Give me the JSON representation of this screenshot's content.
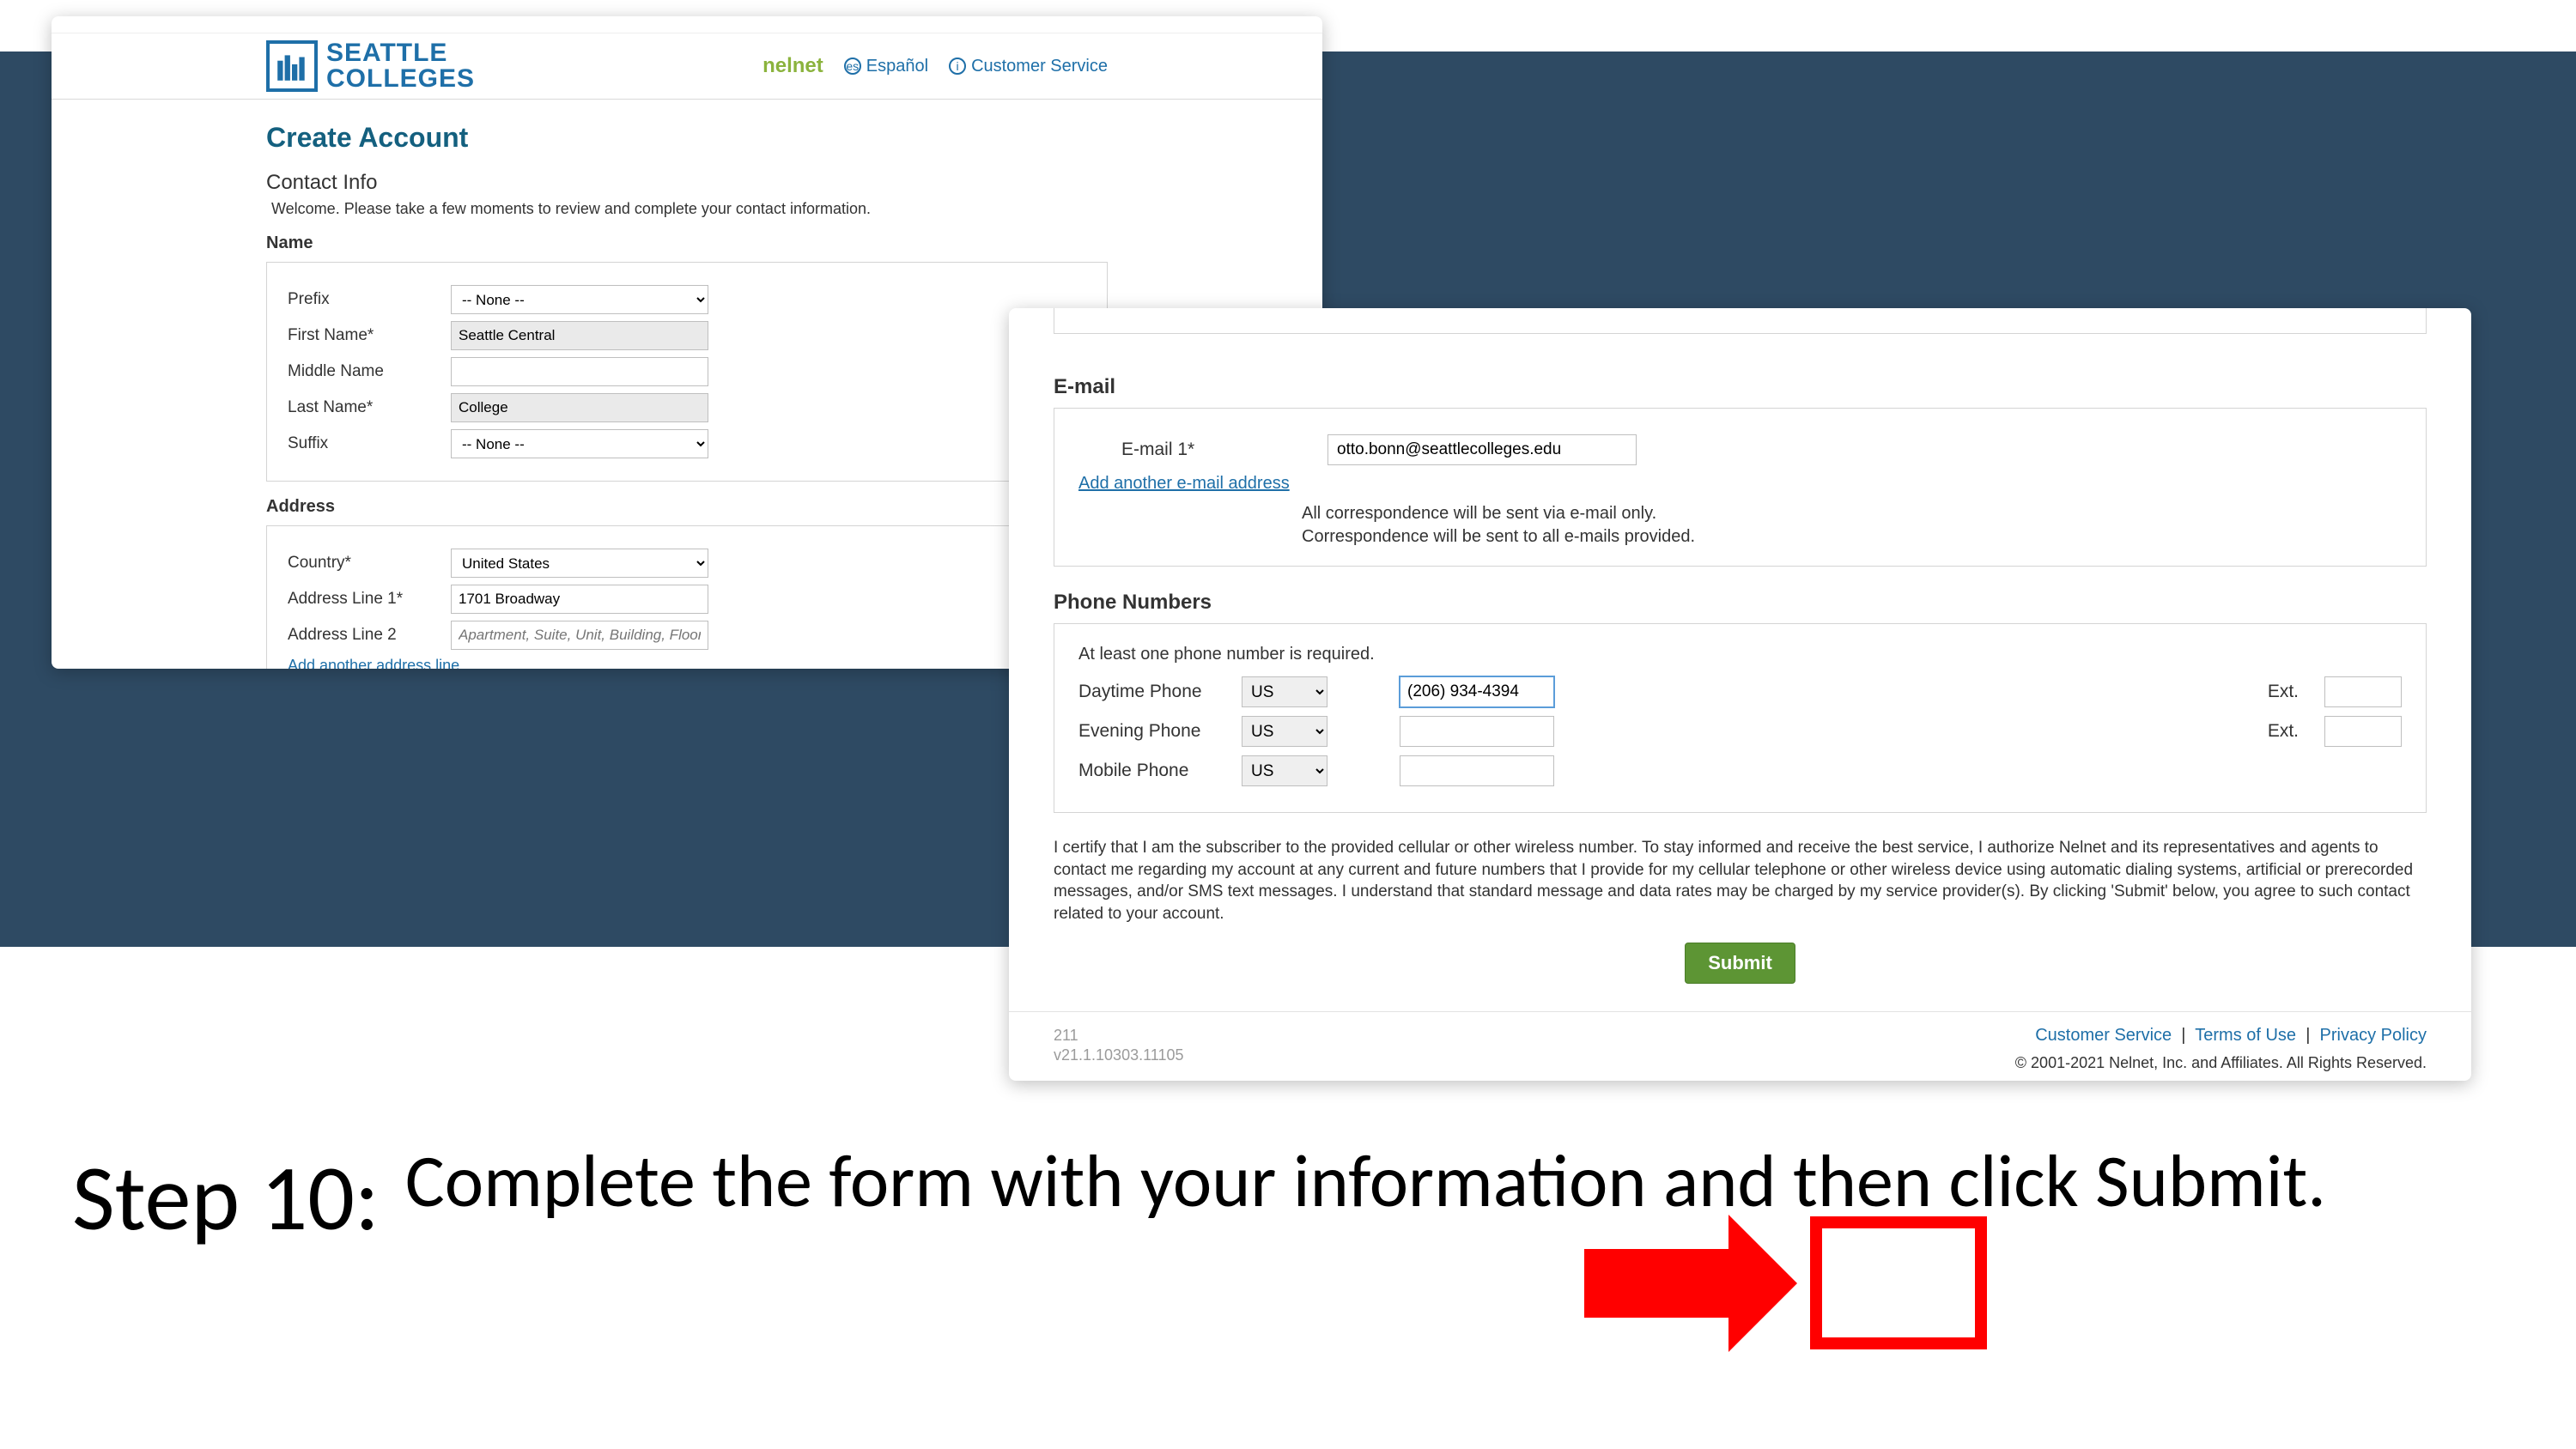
{
  "step": {
    "title": "Step 10:",
    "body": "Complete the form with your information and then click Submit."
  },
  "left": {
    "brand": {
      "line1": "SEATTLE",
      "line2": "COLLEGES"
    },
    "header": {
      "nelnet": "nelnet",
      "espanol": "Español",
      "cust": "Customer Service"
    },
    "create": "Create Account",
    "contact_h": "Contact Info",
    "welcome": "Welcome. Please take a few moments to review and complete your contact information.",
    "name_h": "Name",
    "fields": {
      "prefix_lbl": "Prefix",
      "prefix_val": "-- None --",
      "first_lbl": "First Name*",
      "first_val": "Seattle Central",
      "mid_lbl": "Middle Name",
      "mid_val": "",
      "last_lbl": "Last Name*",
      "last_val": "College",
      "suffix_lbl": "Suffix",
      "suffix_val": "-- None --"
    },
    "addr_h": "Address",
    "addr": {
      "country_lbl": "Country*",
      "country_val": "United States",
      "l1_lbl": "Address Line 1*",
      "l1_val": "1701 Broadway",
      "l2_lbl": "Address Line 2",
      "l2_ph": "Apartment, Suite, Unit, Building, Floor, etc.",
      "add_line": "Add another address line"
    }
  },
  "right": {
    "email_h": "E-mail",
    "email1_lbl": "E-mail 1*",
    "email1_val": "otto.bonn@seattlecolleges.edu",
    "add_email": "Add another e-mail address",
    "corr1": "All correspondence will be sent via e-mail only.",
    "corr2": "Correspondence will be sent to all e-mails provided.",
    "phone_h": "Phone Numbers",
    "phone_note": "At least one phone number is required.",
    "day_lbl": "Daytime Phone",
    "eve_lbl": "Evening Phone",
    "mob_lbl": "Mobile Phone",
    "cc": "US",
    "day_val": "(206) 934-4394",
    "ext_lbl": "Ext.",
    "disclaimer": "I certify that I am the subscriber to the provided cellular or other wireless number. To stay informed and receive the best service, I authorize Nelnet and its representatives and agents to contact me regarding my account at any current and future numbers that I provide for my cellular telephone or other wireless device using automatic dialing systems, artificial or prerecorded messages, and/or SMS text messages. I understand that standard message and data rates may be charged by my service provider(s). By clicking 'Submit' below, you agree to such contact related to your account.",
    "submit": "Submit",
    "ver1": "211",
    "ver2": "v21.1.10303.11105",
    "links": {
      "cs": "Customer Service",
      "tou": "Terms of Use",
      "pp": "Privacy Policy",
      "sep": "|"
    },
    "copyright": "© 2001-2021 Nelnet, Inc. and Affiliates. All Rights Reserved."
  }
}
